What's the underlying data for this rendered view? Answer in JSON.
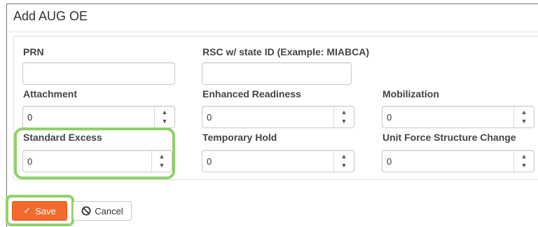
{
  "dialog": {
    "title": "Add AUG OE"
  },
  "form": {
    "prn": {
      "label": "PRN",
      "value": ""
    },
    "rsc": {
      "label": "RSC w/ state ID (Example: MIABCA)",
      "value": ""
    },
    "attachment": {
      "label": "Attachment",
      "value": "0"
    },
    "enhanced_readiness": {
      "label": "Enhanced Readiness",
      "value": "0"
    },
    "mobilization": {
      "label": "Mobilization",
      "value": "0"
    },
    "standard_excess": {
      "label": "Standard Excess",
      "value": "0"
    },
    "temporary_hold": {
      "label": "Temporary Hold",
      "value": "0"
    },
    "unit_force_structure_change": {
      "label": "Unit Force Structure Change",
      "value": "0"
    }
  },
  "spinner": {
    "up_glyph": "▲",
    "down_glyph": "▼"
  },
  "actions": {
    "save_label": "Save",
    "save_icon": "✓",
    "cancel_label": "Cancel"
  },
  "colors": {
    "save_bg": "#f26a2c",
    "highlight": "#8fd16a"
  }
}
